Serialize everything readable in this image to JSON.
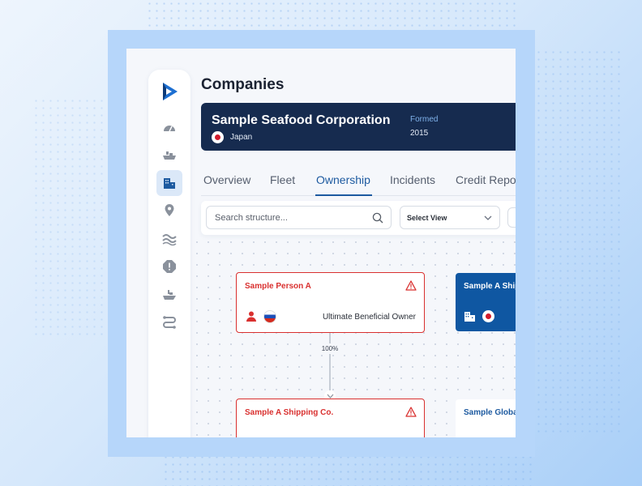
{
  "page": {
    "title": "Companies"
  },
  "company": {
    "name": "Sample Seafood Corporation",
    "country": "Japan",
    "formed_label": "Formed",
    "formed_value": "2015"
  },
  "tabs": [
    {
      "label": "Overview"
    },
    {
      "label": "Fleet"
    },
    {
      "label": "Ownership",
      "active": true
    },
    {
      "label": "Incidents"
    },
    {
      "label": "Credit Report"
    }
  ],
  "toolbar": {
    "search_placeholder": "Search structure...",
    "select_view_label": "Select View"
  },
  "structure": {
    "person_node": {
      "title": "Sample Person A",
      "role": "Ultimate Beneficial Owner"
    },
    "edge_label": "100%",
    "shipping_node": {
      "title": "Sample A  Shipping Co."
    },
    "blue_node": {
      "title": "Sample A Shipping"
    },
    "global_node": {
      "title": "Sample Global"
    }
  },
  "sidebar": {
    "items": [
      {
        "icon": "dashboard-icon"
      },
      {
        "icon": "ship-icon"
      },
      {
        "icon": "building-icon",
        "active": true
      },
      {
        "icon": "location-pin-icon"
      },
      {
        "icon": "waves-icon"
      },
      {
        "icon": "alert-octagon-icon"
      },
      {
        "icon": "vessel-icon"
      },
      {
        "icon": "route-icon"
      }
    ]
  },
  "colors": {
    "accent": "#1d5aa0",
    "header_bg": "#162b4f",
    "alert_red": "#d9302f"
  }
}
